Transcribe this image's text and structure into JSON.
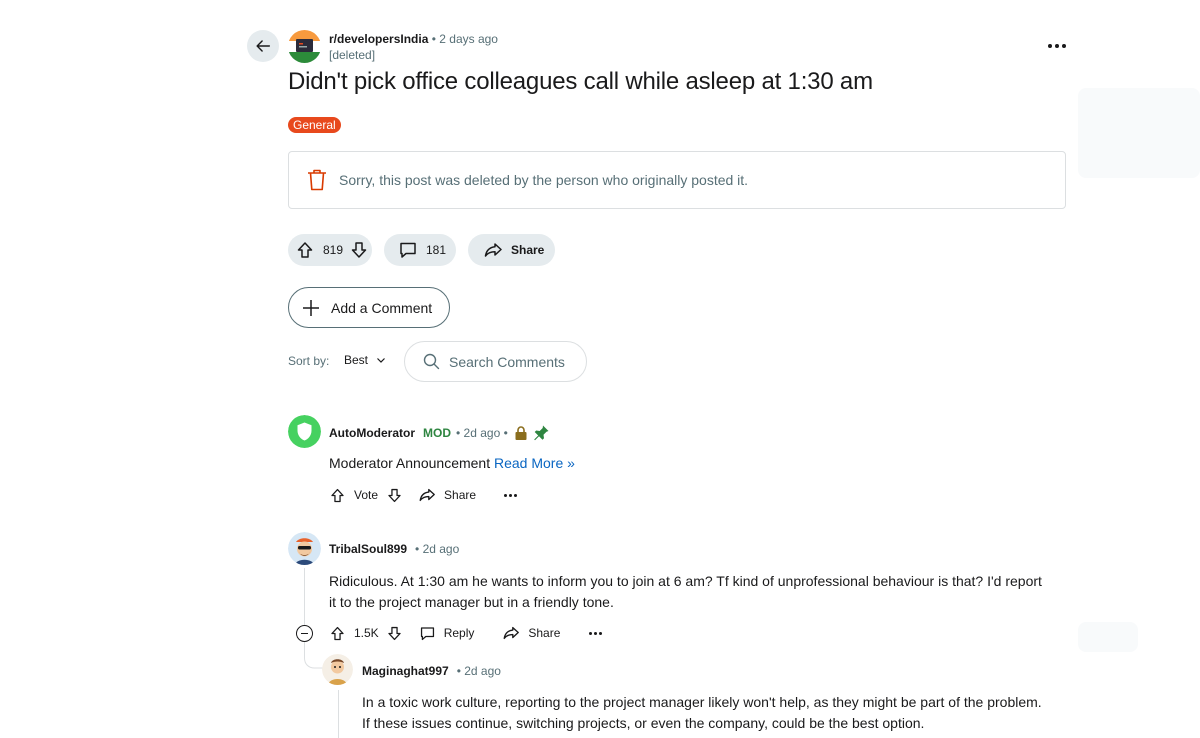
{
  "post": {
    "subreddit": "r/developersIndia",
    "separator": "•",
    "time": "2 days ago",
    "author": "[deleted]",
    "title": "Didn't pick office colleagues call while asleep at 1:30 am",
    "flair": "General",
    "flair_color": "#e8491d",
    "deleted_message": "Sorry, this post was deleted by the person who originally posted it.",
    "votes": "819",
    "comments": "181",
    "share_label": "Share"
  },
  "composer": {
    "add_comment_label": "Add a Comment",
    "sort_label": "Sort by:",
    "sort_value": "Best",
    "search_placeholder": "Search Comments"
  },
  "comments": [
    {
      "author": "AutoModerator",
      "badge": "MOD",
      "meta": "• 2d ago •",
      "body": "Moderator Announcement",
      "link": "Read More »",
      "vote_label": "Vote",
      "share_label": "Share",
      "icons": [
        "lock-icon",
        "pin-icon"
      ]
    },
    {
      "author": "TribalSoul899",
      "meta": "• 2d ago",
      "body": "Ridiculous. At 1:30 am he wants to inform you to join at 6 am? Tf kind of unprofessional behaviour is that? I'd report it to the project manager but in a friendly tone.",
      "votes": "1.5K",
      "reply_label": "Reply",
      "share_label": "Share"
    },
    {
      "author": "Maginaghat997",
      "meta": "• 2d ago",
      "body": "In a toxic work culture, reporting to the project manager likely won't help, as they might be part of the problem. If these issues continue, switching projects, or even the company, could be the best option."
    }
  ],
  "colors": {
    "mod_green": "#2e8540",
    "link_blue": "#0a66c2",
    "muted_text": "#576f76",
    "pill_bg": "#e5ebee"
  }
}
